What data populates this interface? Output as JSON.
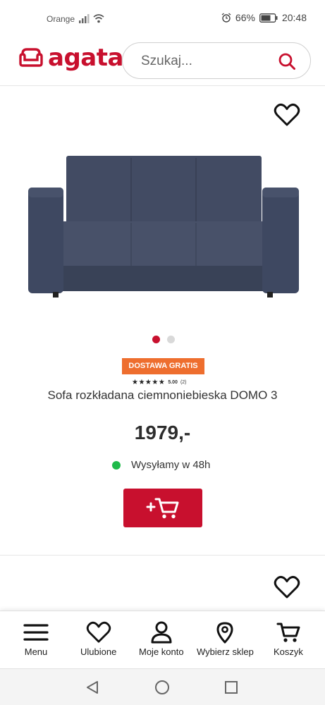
{
  "status_bar": {
    "carrier": "Orange",
    "battery": "66%",
    "time": "20:48"
  },
  "header": {
    "logo_text": "agata",
    "search": {
      "placeholder": "Szukaj..."
    }
  },
  "product": {
    "badge": "DOSTAWA GRATIS",
    "rating_value": "5.00",
    "rating_count": "(2)",
    "stars": 5,
    "title": "Sofa rozkładana ciemnoniebieska DOMO 3",
    "price": "1979,-",
    "shipping": "Wysyłamy w 48h",
    "cart_button_icon": "add-to-cart-icon",
    "image_dots": 2,
    "active_dot": 1
  },
  "bottom_nav": {
    "items": [
      {
        "label": "Menu",
        "icon": "hamburger-icon"
      },
      {
        "label": "Ulubione",
        "icon": "heart-icon"
      },
      {
        "label": "Moje konto",
        "icon": "user-icon"
      },
      {
        "label": "Wybierz sklep",
        "icon": "map-pin-icon"
      },
      {
        "label": "Koszyk",
        "icon": "cart-icon"
      }
    ]
  },
  "colors": {
    "brand": "#c8102e",
    "badge": "#ee6e2e",
    "available": "#1fba4a",
    "sofa": "#3e4861"
  }
}
